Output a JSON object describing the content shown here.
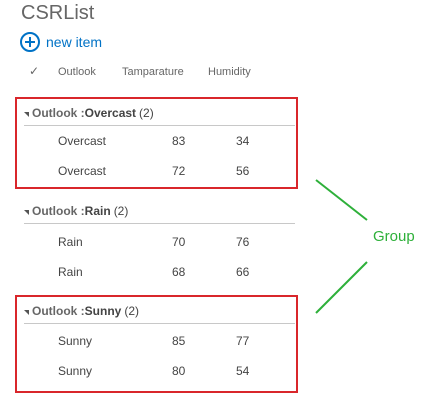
{
  "app": {
    "title": "CSRList"
  },
  "toolbar": {
    "new_item_label": "new item",
    "new_item_icon": "plus-circle-icon"
  },
  "columns": {
    "check_icon": "✓",
    "outlook": "Outlook",
    "temperature": "Tamparature",
    "humidity": "Humidity"
  },
  "groups": [
    {
      "field": "Outlook : ",
      "value": "Overcast",
      "count": "(2)",
      "rows": [
        {
          "outlook": "Overcast",
          "temperature": "83",
          "humidity": "34"
        },
        {
          "outlook": "Overcast",
          "temperature": "72",
          "humidity": "56"
        }
      ]
    },
    {
      "field": "Outlook : ",
      "value": "Rain",
      "count": "(2)",
      "rows": [
        {
          "outlook": "Rain",
          "temperature": "70",
          "humidity": "76"
        },
        {
          "outlook": "Rain",
          "temperature": "68",
          "humidity": "66"
        }
      ]
    },
    {
      "field": "Outlook : ",
      "value": "Sunny",
      "count": "(2)",
      "rows": [
        {
          "outlook": "Sunny",
          "temperature": "85",
          "humidity": "77"
        },
        {
          "outlook": "Sunny",
          "temperature": "80",
          "humidity": "54"
        }
      ]
    }
  ],
  "annotation": {
    "label": "Group",
    "arrow_color": "#2eb03a",
    "box_color": "#d9262b"
  }
}
